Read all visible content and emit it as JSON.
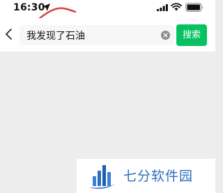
{
  "status_bar": {
    "time": "16:30",
    "icons": [
      "location-arrow-icon",
      "signal-icon",
      "wifi-icon",
      "battery-icon"
    ]
  },
  "search": {
    "query": "我发现了石油",
    "button_label": "搜索",
    "accent_color": "#07c160"
  },
  "watermark": {
    "text": "七分软件园",
    "color": "#2c6fbf"
  }
}
